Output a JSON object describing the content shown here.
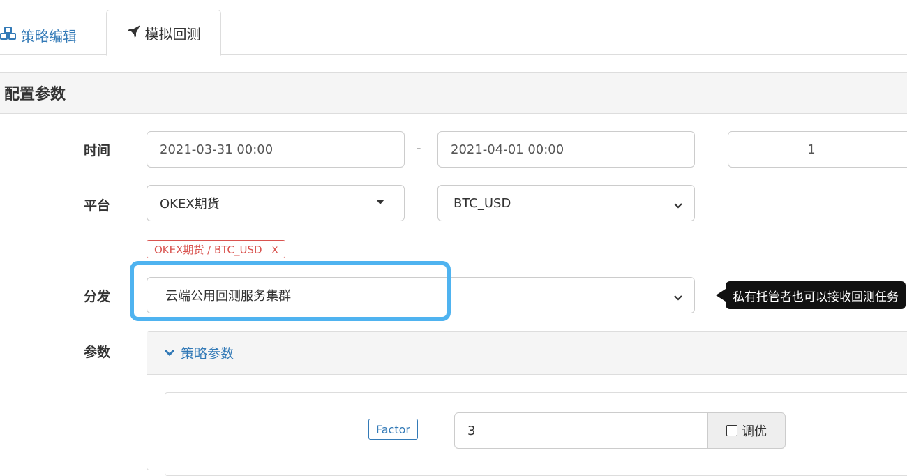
{
  "tabs": {
    "strategy_edit": "策略编辑",
    "backtest": "模拟回测"
  },
  "section": {
    "title": "配置参数"
  },
  "time": {
    "label": "时间",
    "start": "2021-03-31 00:00",
    "separator": "-",
    "end": "2021-04-01 00:00",
    "period": "1"
  },
  "platform": {
    "label": "平台",
    "exchange": "OKEX期货",
    "pair": "BTC_USD",
    "tag_text": "OKEX期货 / BTC_USD",
    "tag_remove": "x"
  },
  "dispatch": {
    "label": "分发",
    "value": "云端公用回测服务集群",
    "tooltip": "私有托管者也可以接收回测任务"
  },
  "params": {
    "label": "参数",
    "panel_title": "策略参数",
    "factor_label": "Factor",
    "factor_value": "3",
    "tune_label": "调优"
  },
  "colors": {
    "link": "#337ab7",
    "danger": "#d9534f",
    "highlight": "#4fb3f0"
  }
}
